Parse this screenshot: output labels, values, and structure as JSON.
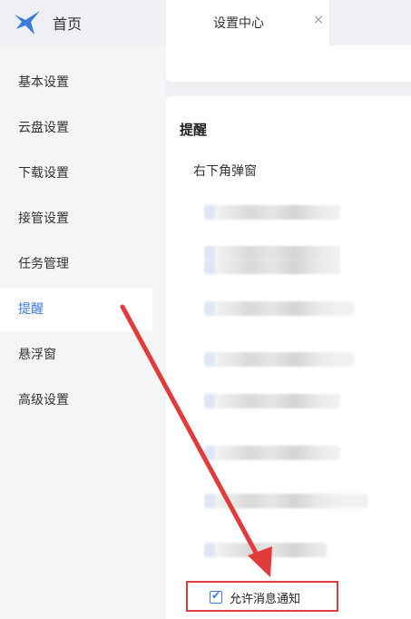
{
  "header": {
    "home_label": "首页"
  },
  "tab": {
    "label": "设置中心",
    "close_glyph": "×"
  },
  "sidebar": {
    "items": [
      {
        "label": "基本设置"
      },
      {
        "label": "云盘设置"
      },
      {
        "label": "下载设置"
      },
      {
        "label": "接管设置"
      },
      {
        "label": "任务管理"
      },
      {
        "label": "提醒",
        "active": true
      },
      {
        "label": "悬浮窗"
      },
      {
        "label": "高级设置"
      }
    ]
  },
  "main": {
    "section_title": "提醒",
    "subsection_title": "右下角弹窗",
    "allow_notify": {
      "label": "允许消息通知",
      "checked": true
    }
  },
  "colors": {
    "accent": "#3d78e6",
    "annotation_red": "#e23b3b"
  },
  "icons": {
    "logo": "bird-logo-icon",
    "close": "close-icon",
    "check": "checkmark-icon"
  }
}
